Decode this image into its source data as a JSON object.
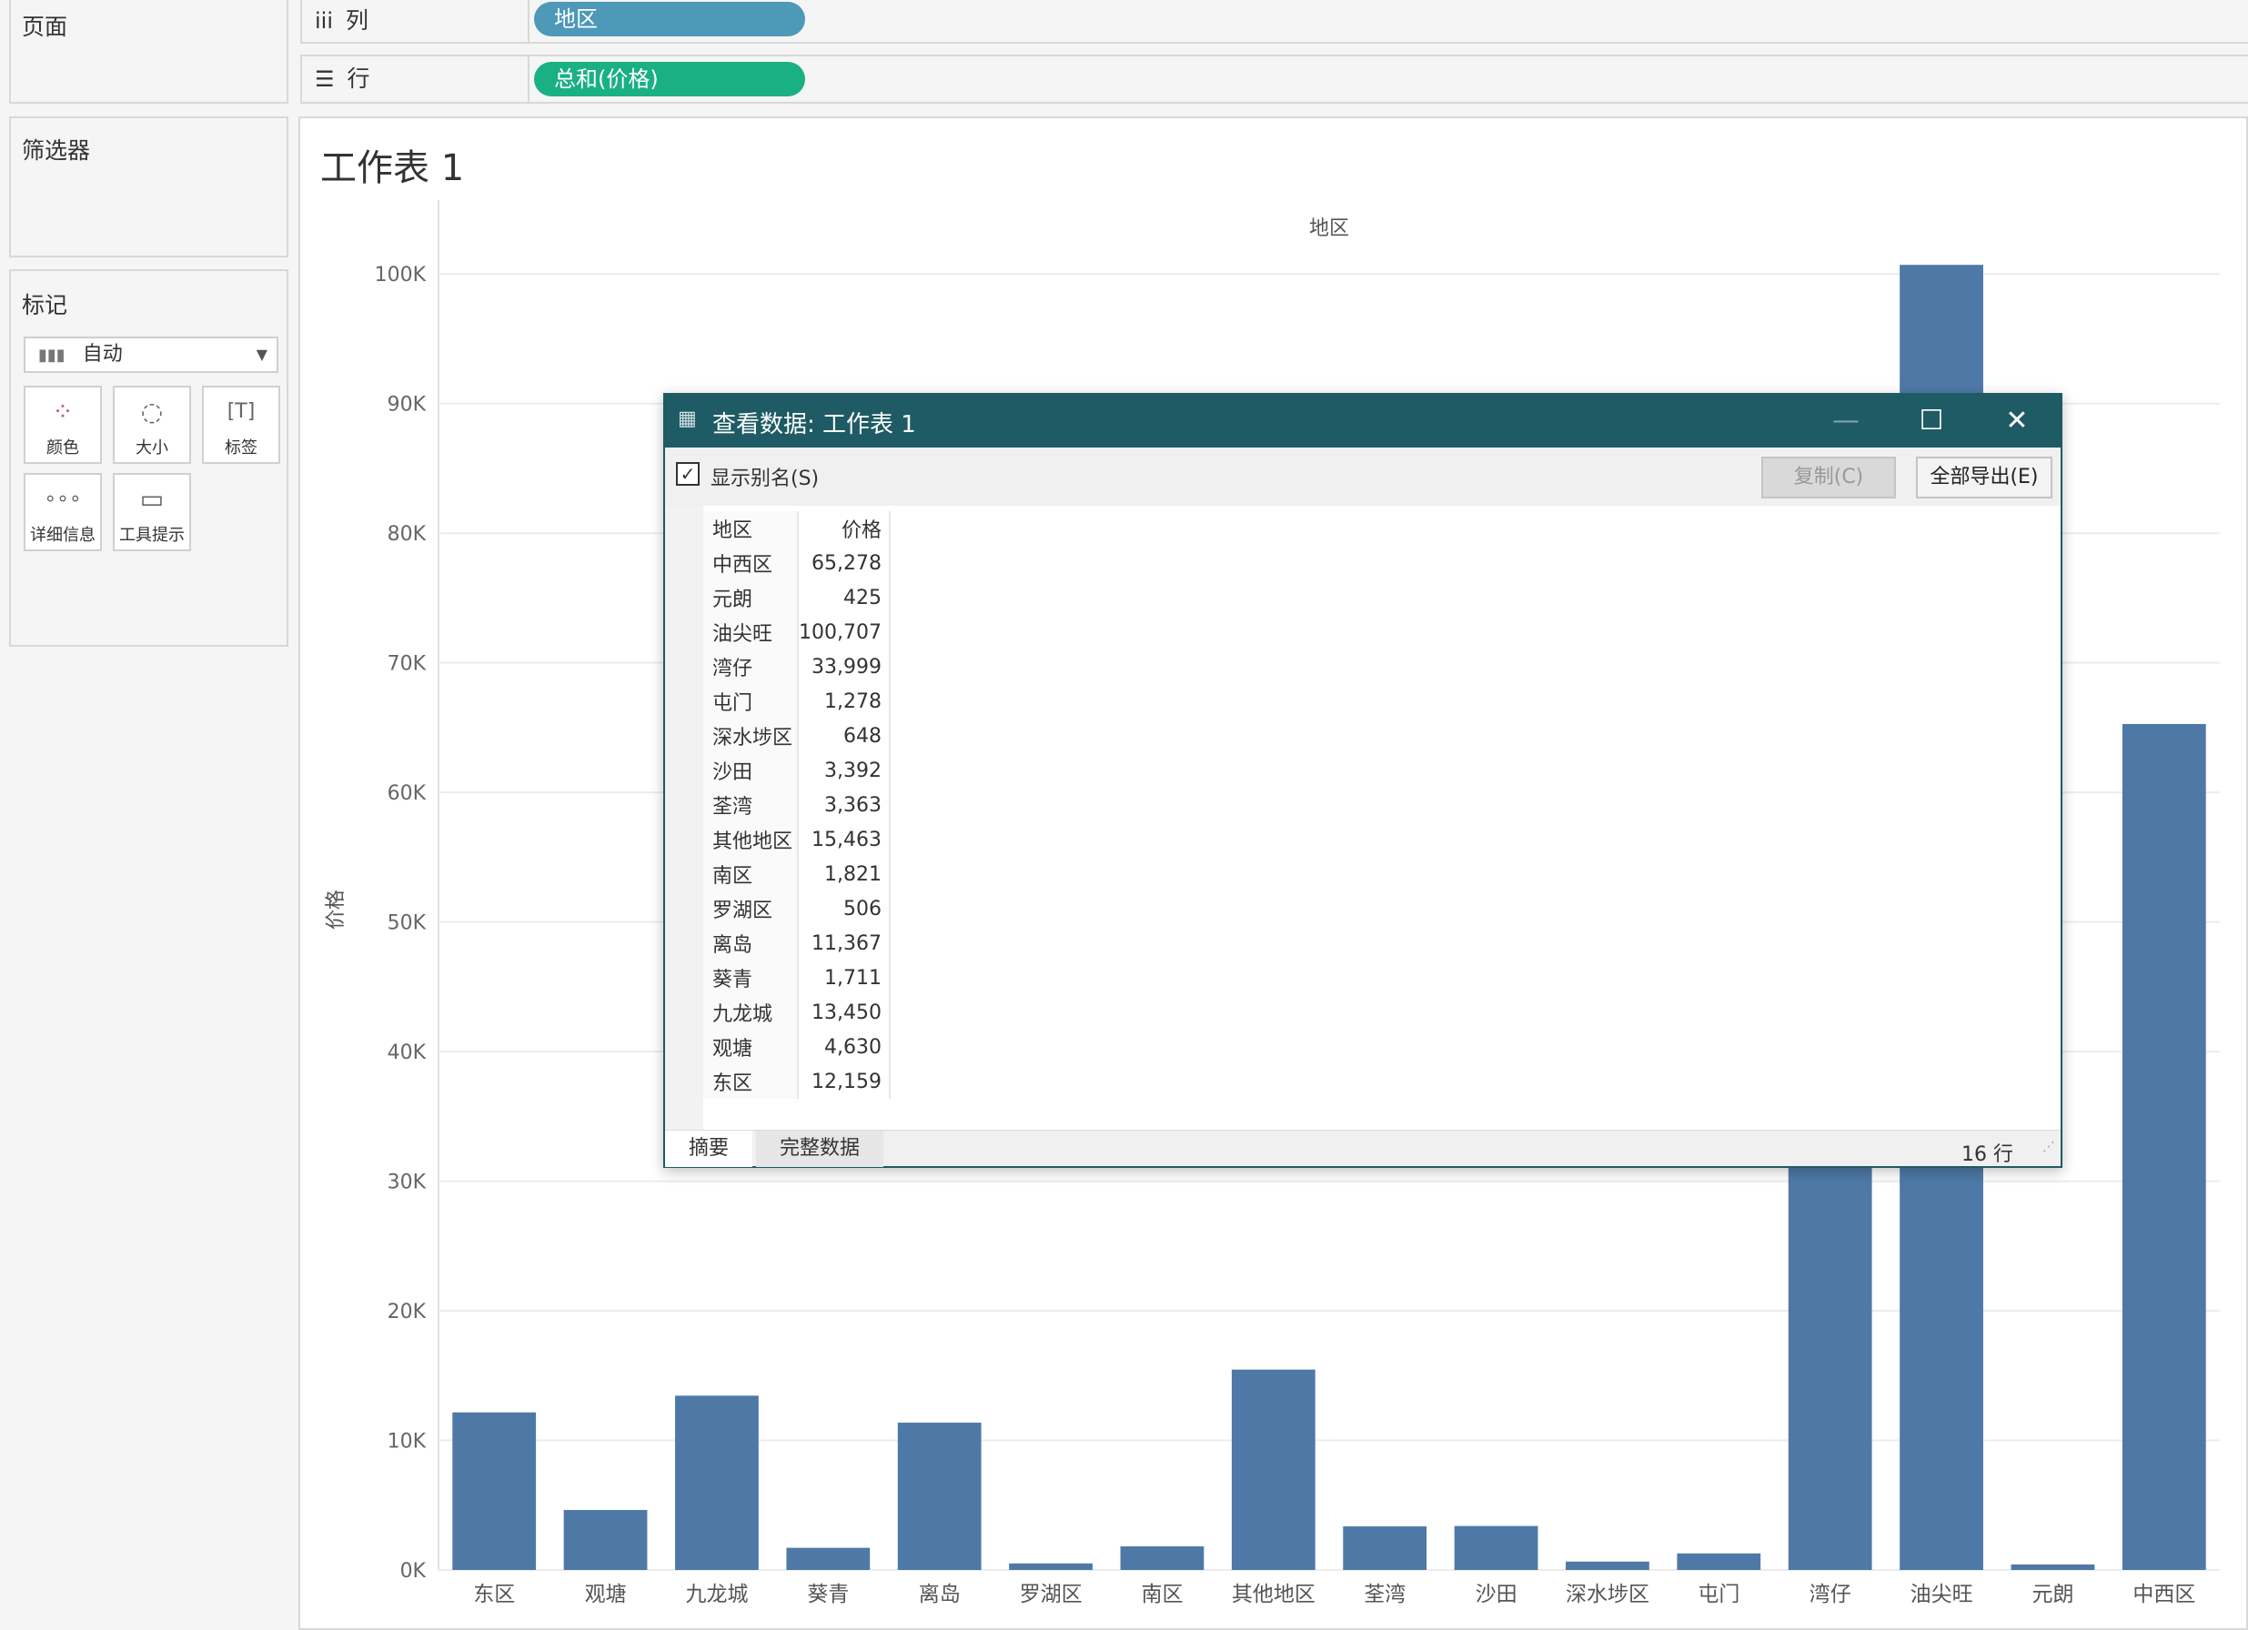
{
  "pages_panel": {
    "title": "页面"
  },
  "filters_panel": {
    "title": "筛选器"
  },
  "marks_panel": {
    "title": "标记",
    "mark_type": "自动",
    "buttons": [
      {
        "label": "颜色",
        "icon": "color-icon"
      },
      {
        "label": "大小",
        "icon": "size-icon"
      },
      {
        "label": "标签",
        "icon": "label-icon"
      },
      {
        "label": "详细信息",
        "icon": "detail-icon"
      },
      {
        "label": "工具提示",
        "icon": "tooltip-icon"
      }
    ]
  },
  "shelves": {
    "columns": {
      "label": "列",
      "pill": "地区",
      "pill_color": "#4e98b8"
    },
    "rows": {
      "label": "行",
      "pill": "总和(价格)",
      "pill_color": "#19b084"
    }
  },
  "worksheet": {
    "title": "工作表 1"
  },
  "chart_data": {
    "type": "bar",
    "title": "地区",
    "xlabel": "",
    "ylabel": "价格",
    "ylim": [
      0,
      105000
    ],
    "yticks": [
      0,
      10000,
      20000,
      30000,
      40000,
      50000,
      60000,
      70000,
      80000,
      90000,
      100000
    ],
    "ytick_labels": [
      "0K",
      "10K",
      "20K",
      "30K",
      "40K",
      "50K",
      "60K",
      "70K",
      "80K",
      "90K",
      "100K"
    ],
    "categories": [
      "东区",
      "观塘",
      "九龙城",
      "葵青",
      "离岛",
      "罗湖区",
      "南区",
      "其他地区",
      "荃湾",
      "沙田",
      "深水埗区",
      "屯门",
      "湾仔",
      "油尖旺",
      "元朗",
      "中西区"
    ],
    "values": [
      12159,
      4630,
      13450,
      1711,
      11367,
      506,
      1821,
      15463,
      3363,
      3392,
      648,
      1278,
      33999,
      100707,
      425,
      65278
    ],
    "bar_color": "#4e79a7",
    "grid": true
  },
  "dialog": {
    "title": "查看数据: 工作表 1",
    "show_alias_label": "显示别名(S)",
    "show_alias_checked": true,
    "copy_label": "复制(C)",
    "export_label": "全部导出(E)",
    "table": {
      "headers": [
        "地区",
        "价格"
      ],
      "rows": [
        [
          "中西区",
          "65,278"
        ],
        [
          "元朗",
          "425"
        ],
        [
          "油尖旺",
          "100,707"
        ],
        [
          "湾仔",
          "33,999"
        ],
        [
          "屯门",
          "1,278"
        ],
        [
          "深水埗区",
          "648"
        ],
        [
          "沙田",
          "3,392"
        ],
        [
          "荃湾",
          "3,363"
        ],
        [
          "其他地区",
          "15,463"
        ],
        [
          "南区",
          "1,821"
        ],
        [
          "罗湖区",
          "506"
        ],
        [
          "离岛",
          "11,367"
        ],
        [
          "葵青",
          "1,711"
        ],
        [
          "九龙城",
          "13,450"
        ],
        [
          "观塘",
          "4,630"
        ],
        [
          "东区",
          "12,159"
        ]
      ]
    },
    "tabs": [
      "摘要",
      "完整数据"
    ],
    "row_count": "16 行"
  }
}
